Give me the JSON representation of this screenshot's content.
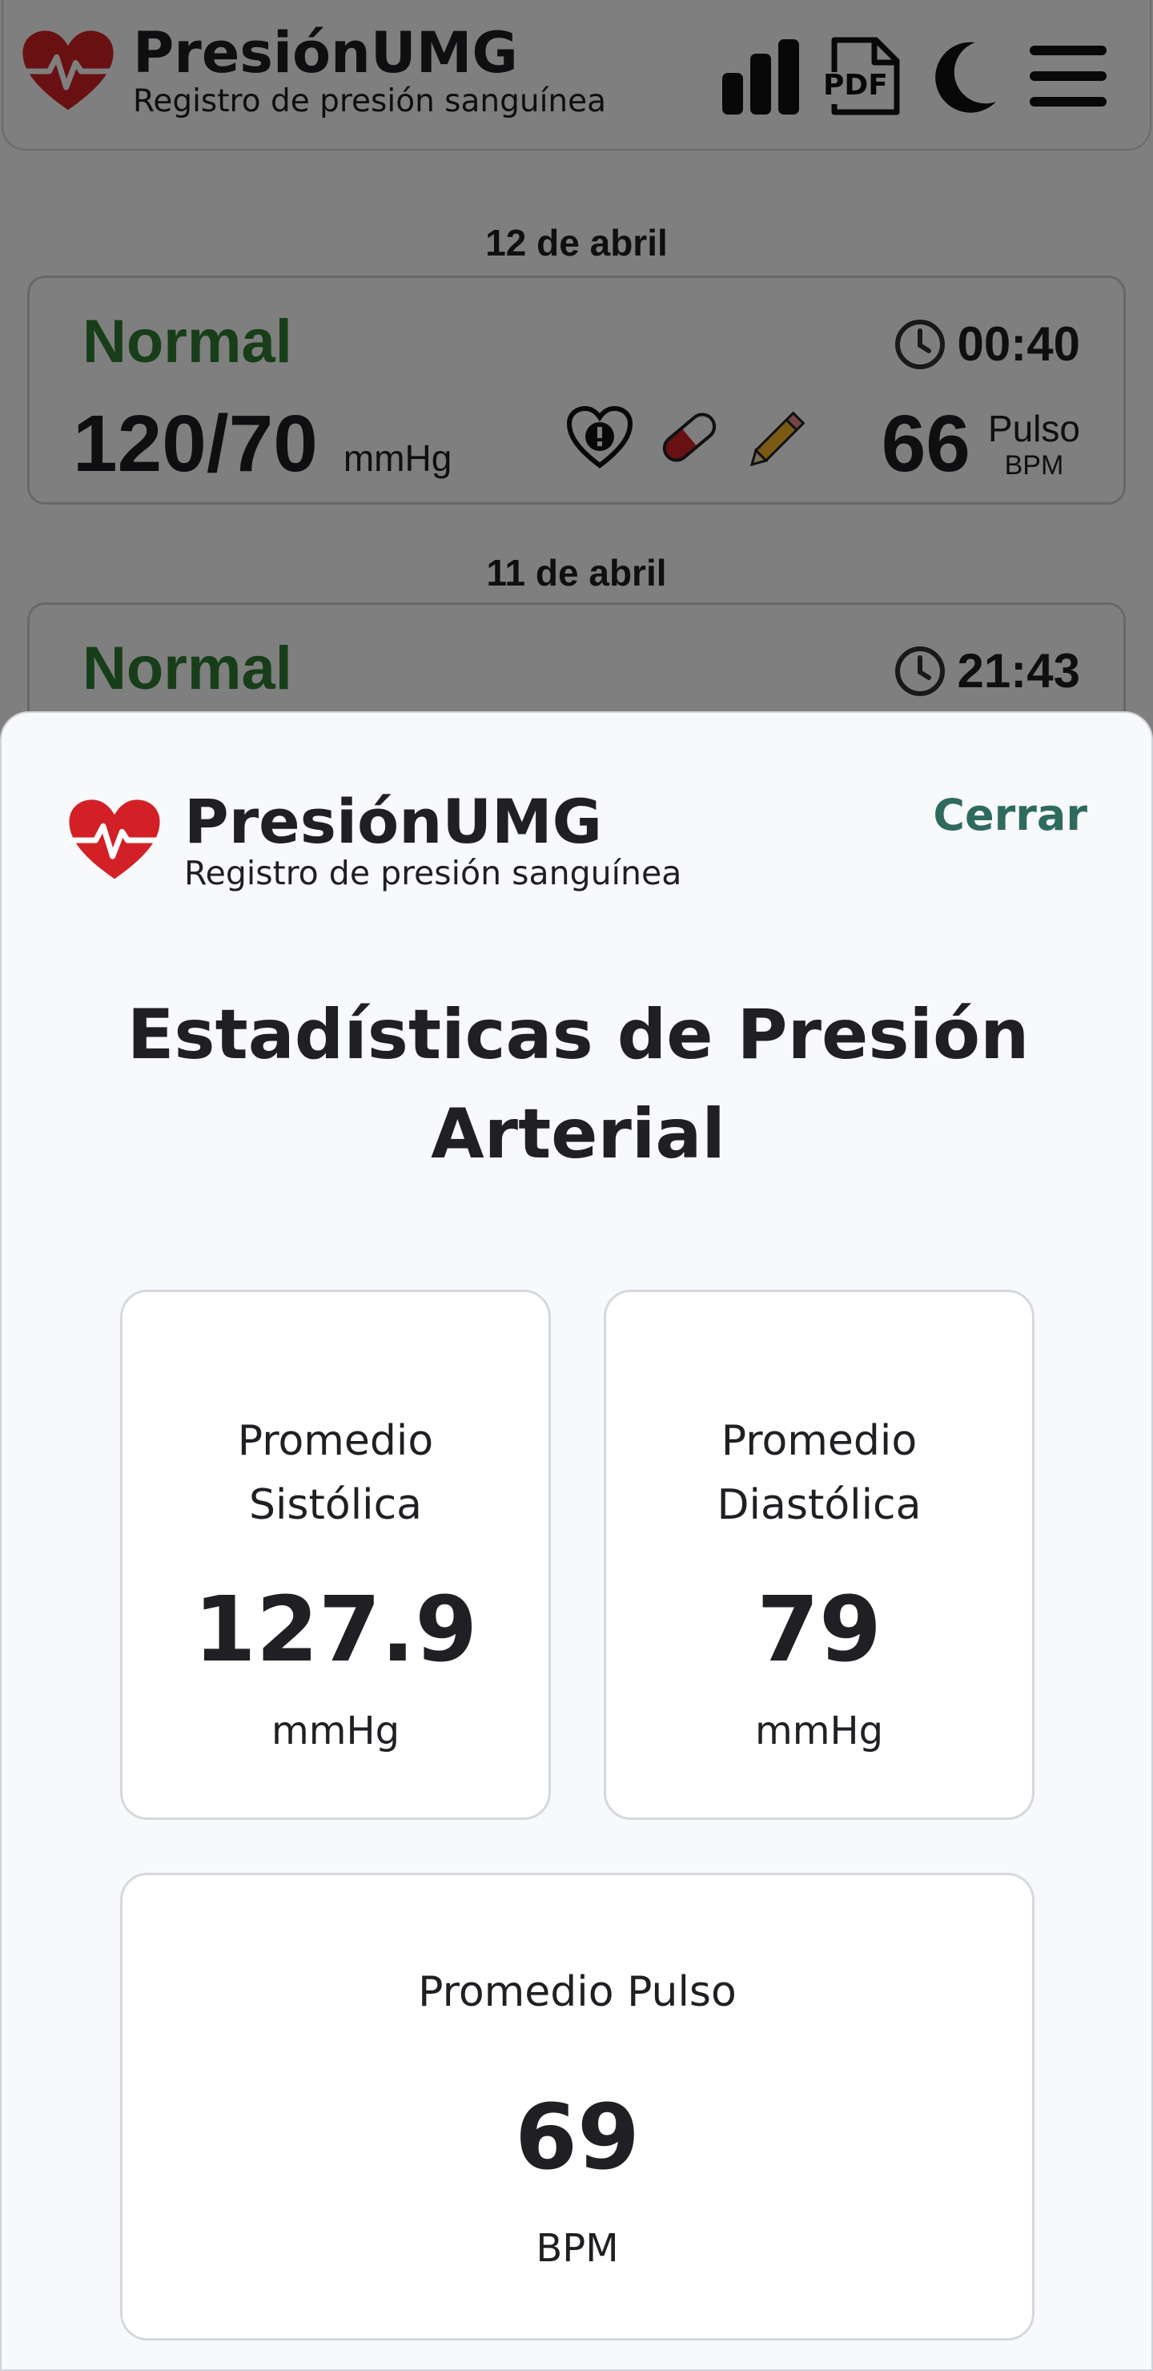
{
  "app": {
    "title": "PresiónUMG",
    "subtitle": "Registro de presión sanguínea"
  },
  "header_icons": [
    "bar-chart-icon",
    "pdf-icon",
    "moon-icon",
    "hamburger-menu-icon"
  ],
  "pdf_label": "PDF",
  "readings": [
    {
      "date": "12 de abril",
      "status": "Normal",
      "time": "00:40",
      "bp": "120/70",
      "bp_unit": "mmHg",
      "pulse": "66",
      "pulse_label": "Pulso",
      "pulse_unit": "BPM"
    },
    {
      "date": "11 de abril",
      "status": "Normal",
      "time": "21:43"
    }
  ],
  "colors": {
    "status_normal": "#2e7d32",
    "brand_red": "#d32027",
    "close_accent": "#2e6b5e"
  },
  "sheet": {
    "app_title": "PresiónUMG",
    "app_subtitle": "Registro de presión sanguínea",
    "close_label": "Cerrar",
    "title_line1": "Estadísticas de Presión",
    "title_line2": "Arterial",
    "stats": {
      "systolic": {
        "label_line1": "Promedio",
        "label_line2": "Sistólica",
        "value": "127.9",
        "unit": "mmHg"
      },
      "diastolic": {
        "label_line1": "Promedio",
        "label_line2": "Diastólica",
        "value": "79",
        "unit": "mmHg"
      },
      "pulse": {
        "label": "Promedio Pulso",
        "value": "69",
        "unit": "BPM"
      }
    }
  }
}
